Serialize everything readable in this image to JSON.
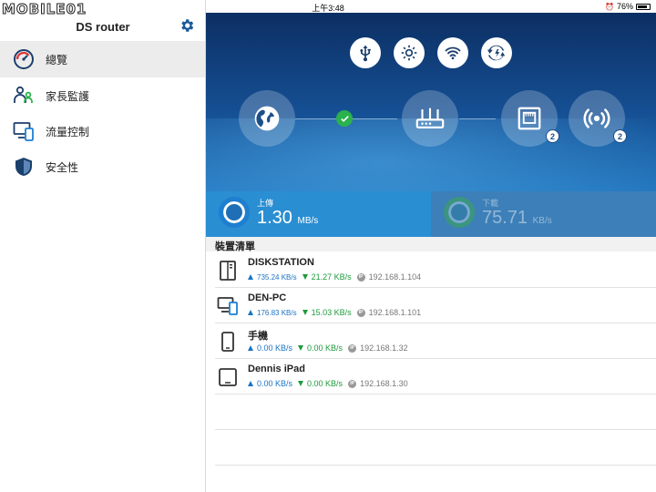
{
  "status_bar": {
    "time": "上午3:48",
    "battery": "76%",
    "battery_level": 0.76
  },
  "watermark": "MOBILE01",
  "sidebar": {
    "title": "DS router",
    "items": [
      {
        "label": "總覽",
        "icon": "gauge-icon",
        "active": true
      },
      {
        "label": "家長監護",
        "icon": "family-icon",
        "active": false
      },
      {
        "label": "流量控制",
        "icon": "devices-icon",
        "active": false
      },
      {
        "label": "安全性",
        "icon": "shield-icon",
        "active": false
      }
    ]
  },
  "hero": {
    "top_icons": [
      "usb-icon",
      "brightness-icon",
      "wifi-icon",
      "sync-icon"
    ],
    "nodes": [
      {
        "name": "internet-node",
        "icon": "globe-icon"
      },
      {
        "name": "router-node",
        "icon": "router-icon"
      },
      {
        "name": "wired-clients-node",
        "icon": "ethernet-icon",
        "badge": "2"
      },
      {
        "name": "wireless-clients-node",
        "icon": "wireless-icon",
        "badge": "2"
      }
    ]
  },
  "speed": {
    "upload": {
      "label": "上傳",
      "value": "1.30",
      "unit": "MB/s"
    },
    "download": {
      "label": "下載",
      "value": "75.71",
      "unit": "KB/s"
    }
  },
  "device_list": {
    "header": "裝置清單",
    "devices": [
      {
        "name": "DISKSTATION",
        "icon": "nas-icon",
        "up": "735.24 KB/s",
        "down": "21.27 KB/s",
        "ip": "192.168.1.104"
      },
      {
        "name": "DEN-PC",
        "icon": "desktop-icon",
        "up": "176.83 KB/s",
        "down": "15.03 KB/s",
        "ip": "192.168.1.101"
      },
      {
        "name": "手機",
        "icon": "phone-icon",
        "up": "0.00 KB/s",
        "down": "0.00 KB/s",
        "ip": "192.168.1.32"
      },
      {
        "name": "Dennis iPad",
        "icon": "tablet-icon",
        "up": "0.00 KB/s",
        "down": "0.00 KB/s",
        "ip": "192.168.1.30"
      }
    ]
  },
  "colors": {
    "upload": "#1a73c4",
    "download": "#1e9a3c",
    "hero_top": "#0c2f63",
    "hero_bottom": "#2377bf"
  }
}
